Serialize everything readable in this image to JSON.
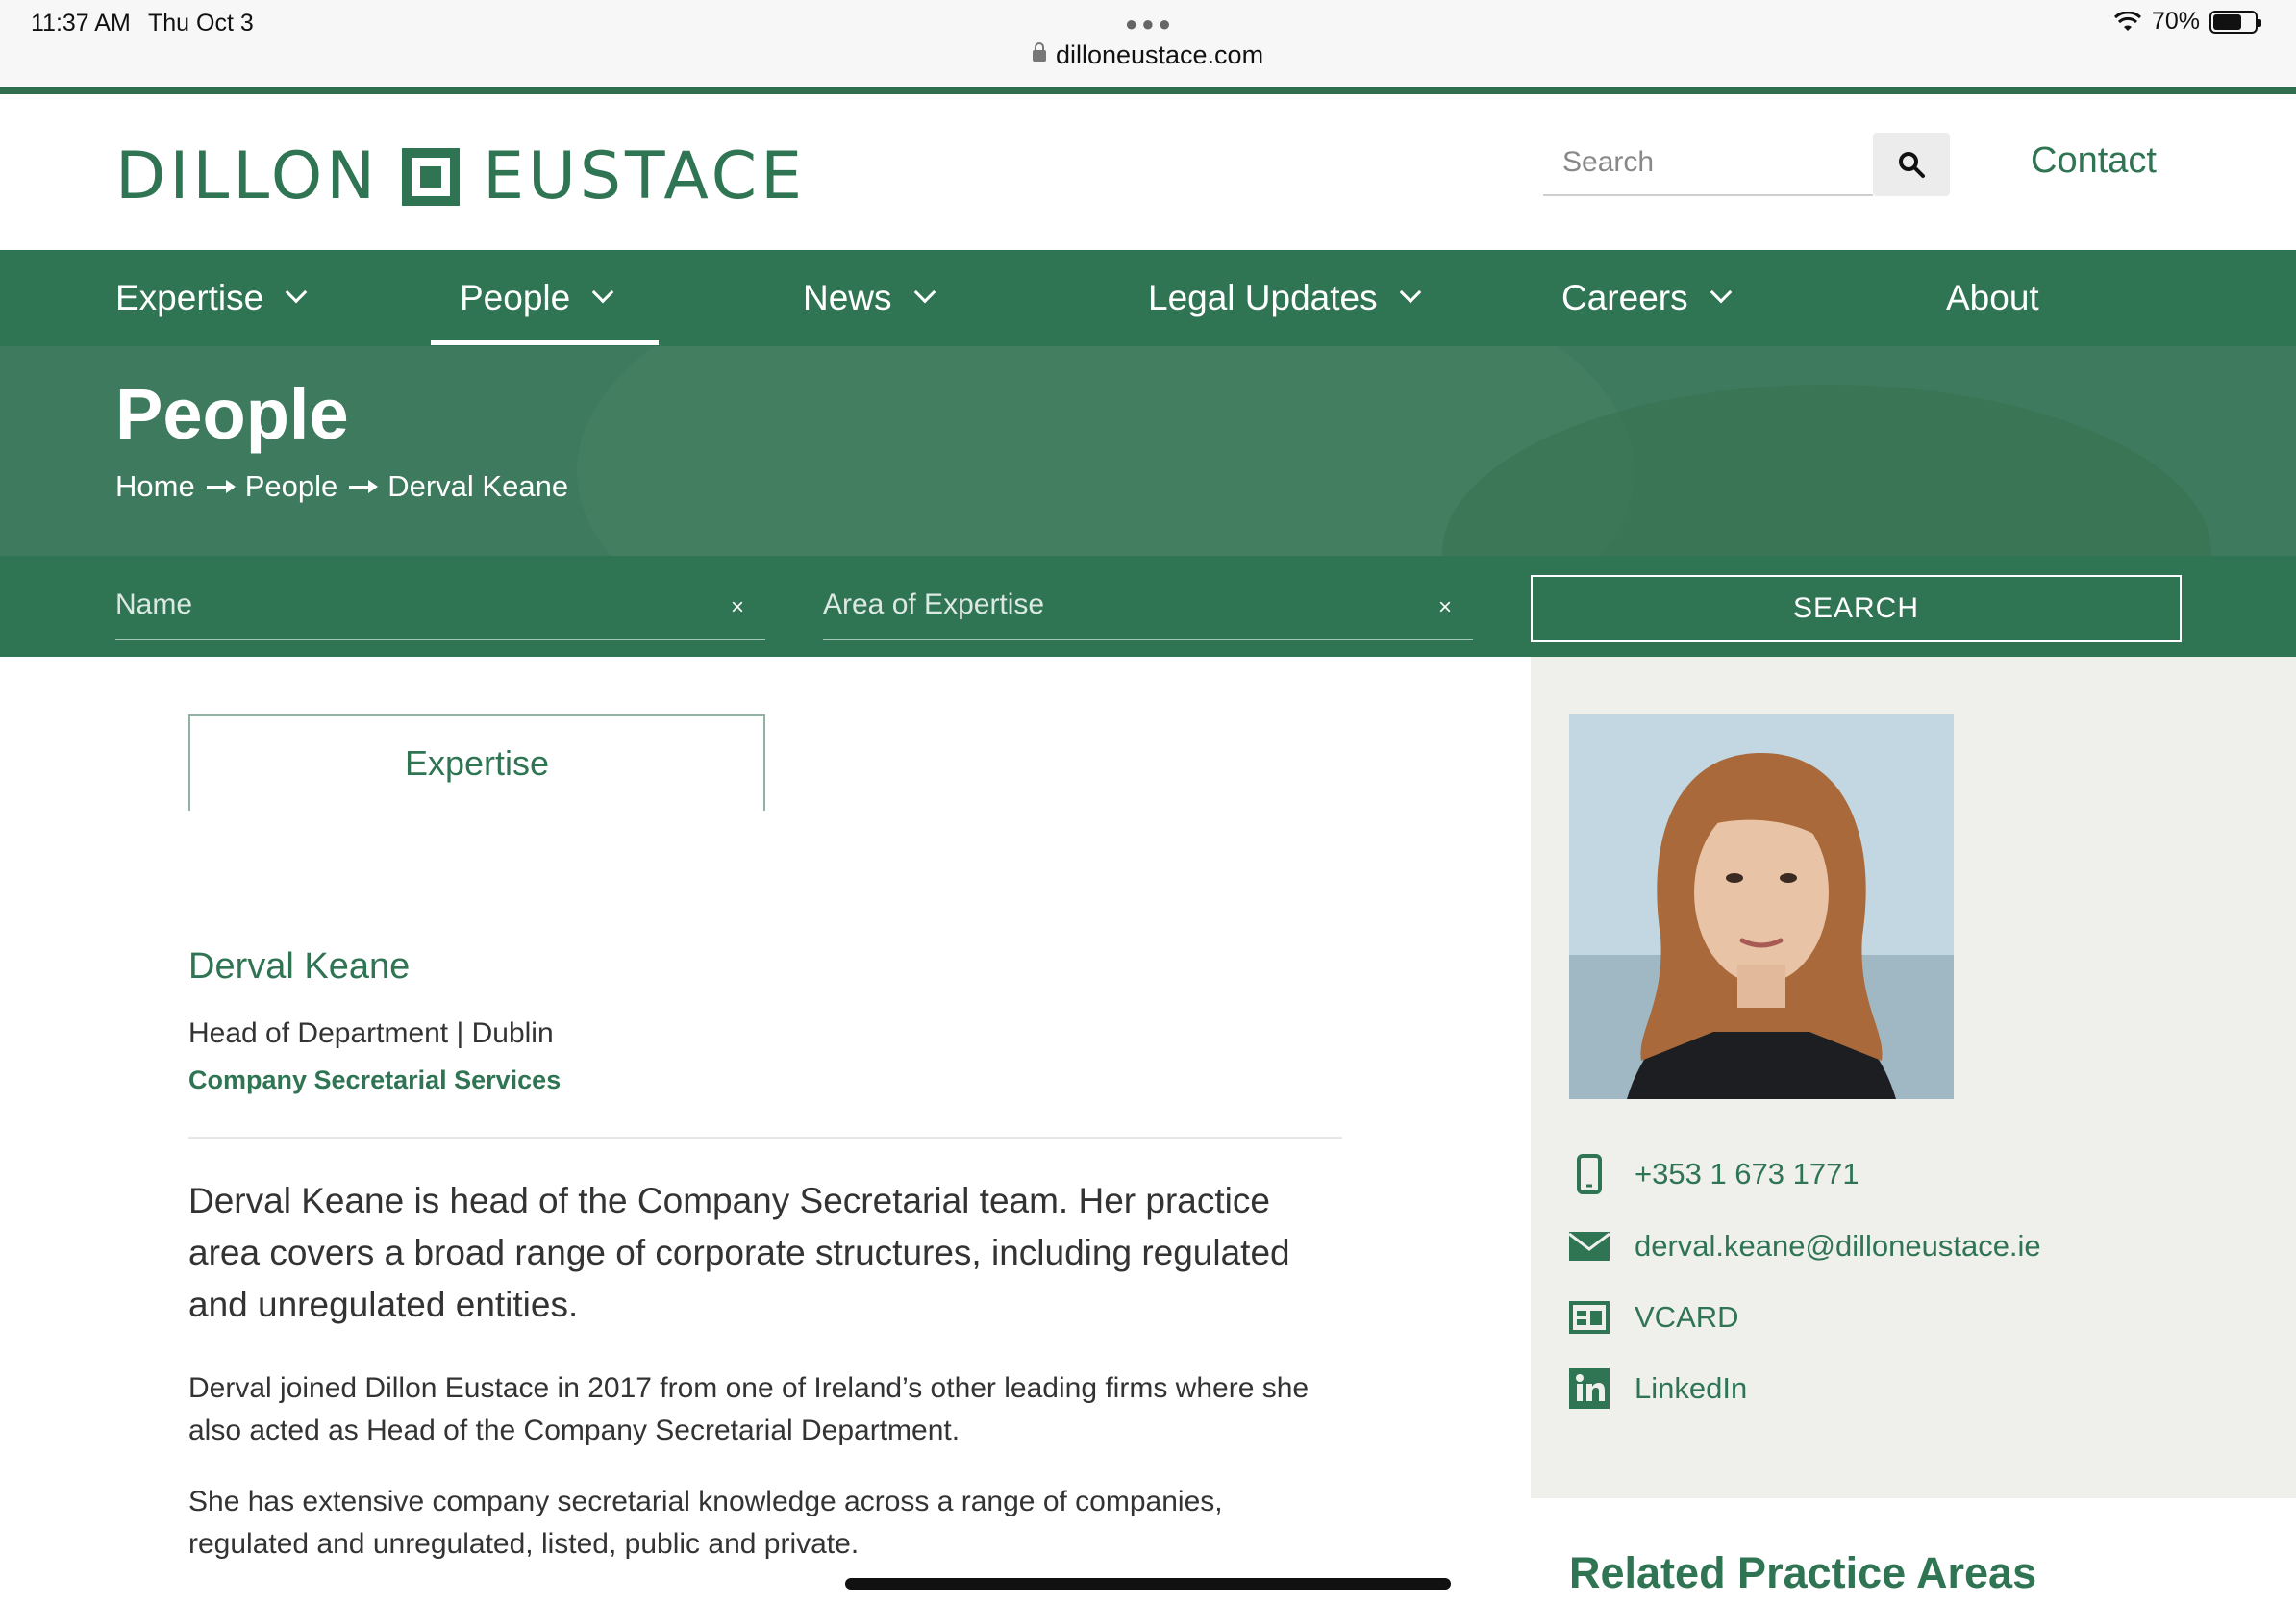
{
  "status_bar": {
    "time": "11:37 AM",
    "date": "Thu Oct 3",
    "battery": "70%",
    "battery_level": 0.7,
    "url": "dilloneustace.com"
  },
  "header": {
    "logo_left": "DILLON",
    "logo_right": "EUSTACE",
    "search_placeholder": "Search",
    "contact_label": "Contact"
  },
  "nav": {
    "items": [
      {
        "label": "Expertise"
      },
      {
        "label": "People"
      },
      {
        "label": "News"
      },
      {
        "label": "Legal Updates"
      },
      {
        "label": "Careers"
      },
      {
        "label": "About"
      }
    ],
    "active": "People"
  },
  "hero": {
    "title": "People",
    "breadcrumb": [
      "Home",
      "People",
      "Derval Keane"
    ]
  },
  "filters": {
    "name_placeholder": "Name",
    "expertise_placeholder": "Area of Expertise",
    "clear_glyph": "×",
    "search_label": "SEARCH"
  },
  "profile": {
    "tab_label": "Expertise",
    "name": "Derval Keane",
    "role": "Head of Department | Dublin",
    "department": "Company Secretarial Services",
    "bio_lead": "Derval Keane is head of the Company Secretarial team. Her practice area covers a broad range of corporate structures, including regulated and unregulated entities.",
    "bio_paragraphs": [
      "Derval joined Dillon Eustace in 2017 from one of Ireland’s other leading firms where she also acted as Head of the Company Secretarial Department.",
      "She has extensive company secretarial knowledge across a range of companies, regulated and unregulated, listed, public and private."
    ]
  },
  "sidebar": {
    "phone": "+353 1 673 1771",
    "email": "derval.keane@dilloneustace.ie",
    "vcard": "VCARD",
    "linkedin": "LinkedIn",
    "related_title": "Related Practice Areas"
  },
  "colors": {
    "brand_green": "#2f7453",
    "sidebar_bg": "#efefec"
  }
}
